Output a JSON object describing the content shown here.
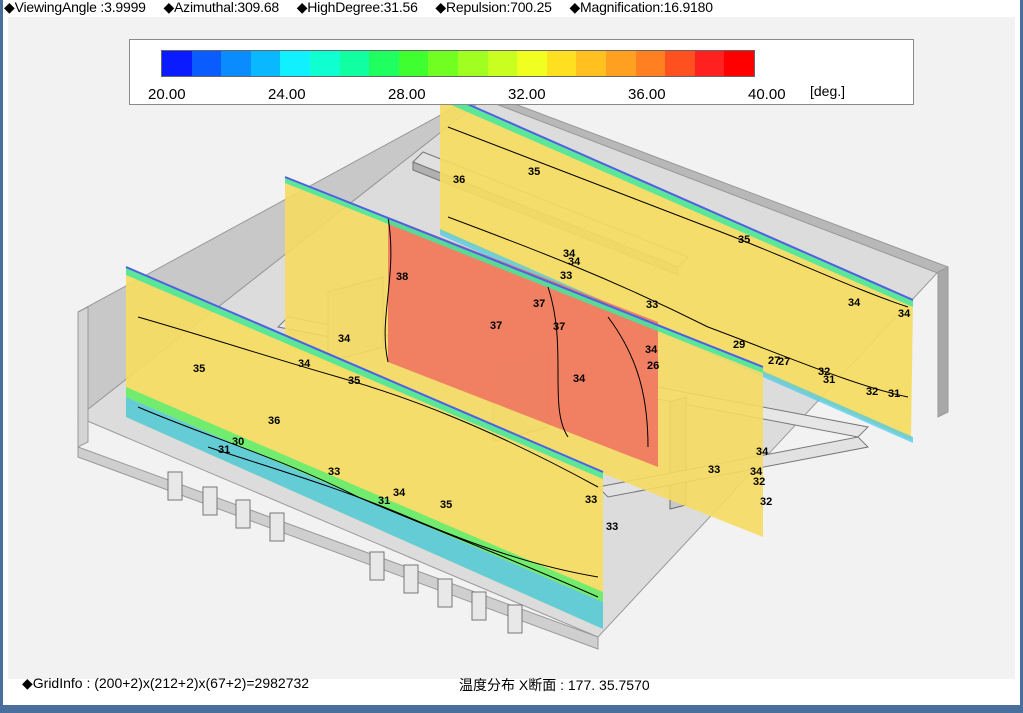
{
  "status": {
    "viewing_angle": "◆ViewingAngle :3.9999",
    "azimuthal": "◆Azimuthal:309.68",
    "high_degree": "◆HighDegree:31.56",
    "repulsion": "◆Repulsion:700.25",
    "magnification": "◆Magnification:16.9180"
  },
  "legend": {
    "colors": [
      "#0a1cff",
      "#0a5cff",
      "#0a8cff",
      "#0ab8ff",
      "#10f0ff",
      "#10ffd0",
      "#10ffa0",
      "#20ff60",
      "#40ff30",
      "#70ff20",
      "#a0ff20",
      "#c8ff20",
      "#f0ff20",
      "#ffe020",
      "#ffc020",
      "#ffa020",
      "#ff8020",
      "#ff5020",
      "#ff2020",
      "#ff0000"
    ],
    "ticks": [
      "20.00",
      "24.00",
      "28.00",
      "32.00",
      "36.00",
      "40.00"
    ],
    "unit": "[deg.]"
  },
  "contour_labels": [
    "35",
    "35",
    "35",
    "34",
    "34",
    "36",
    "37",
    "37",
    "37",
    "38",
    "34",
    "34",
    "35",
    "36",
    "33",
    "34",
    "34",
    "33",
    "34",
    "33",
    "32",
    "31",
    "31",
    "30",
    "34",
    "35",
    "34",
    "33",
    "32",
    "31",
    "29",
    "27",
    "27",
    "26",
    "34",
    "32",
    "31",
    "33",
    "33",
    "34",
    "32"
  ],
  "footer": {
    "grid_info": "◆GridInfo : (200+2)x(212+2)x(67+2)=2982732",
    "section_info": "温度分布 X断面 : 177. 35.7570"
  }
}
